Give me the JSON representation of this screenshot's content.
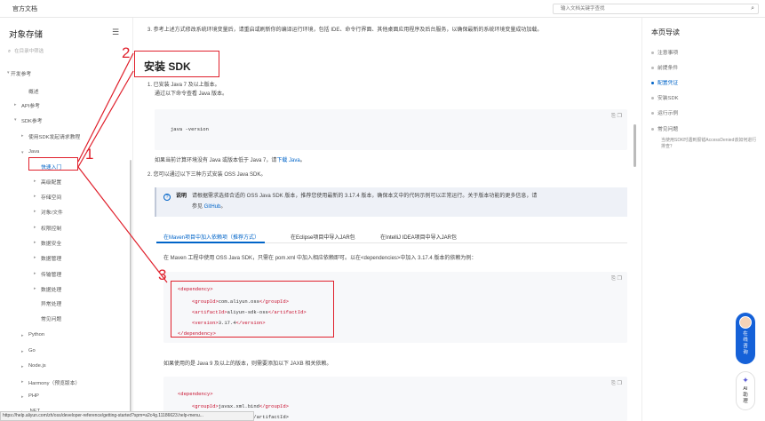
{
  "topbar": {
    "brand": "官方文档",
    "search_placeholder": "输入文档关键字查找",
    "search_icon": "search-icon"
  },
  "sidebar": {
    "title": "对象存储",
    "filter_placeholder": "在目录中筛选",
    "items": [
      {
        "label": "开发参考",
        "arrow": "▾"
      },
      {
        "label": "概述",
        "arrow": ""
      },
      {
        "label": "API参考",
        "arrow": "▸"
      },
      {
        "label": "SDK参考",
        "arrow": "▾"
      },
      {
        "label": "使用SDK发起请求教程",
        "arrow": "▸"
      },
      {
        "label": "Java",
        "arrow": "▾"
      },
      {
        "label": "快速入门",
        "arrow": ""
      },
      {
        "label": "高级配置",
        "arrow": "▸"
      },
      {
        "label": "存储空间",
        "arrow": "▸"
      },
      {
        "label": "对象/文件",
        "arrow": "▸"
      },
      {
        "label": "权限控制",
        "arrow": "▸"
      },
      {
        "label": "数据安全",
        "arrow": "▸"
      },
      {
        "label": "数据管理",
        "arrow": "▸"
      },
      {
        "label": "传输管理",
        "arrow": "▸"
      },
      {
        "label": "数据处理",
        "arrow": "▸"
      },
      {
        "label": "异常处理",
        "arrow": ""
      },
      {
        "label": "常见问题",
        "arrow": ""
      },
      {
        "label": "Python",
        "arrow": "▸"
      },
      {
        "label": "Go",
        "arrow": "▸"
      },
      {
        "label": "Node.js",
        "arrow": "▸"
      },
      {
        "label": "Harmony（预览版本）",
        "arrow": "▸"
      },
      {
        "label": "PHP",
        "arrow": "▸"
      },
      {
        "label": ".NET",
        "arrow": "▸"
      }
    ]
  },
  "status_url": "https://help.aliyun.com/zh/oss/developer-reference/getting-started?spm=a2c4g.11186623.help-menu...",
  "content": {
    "step3": "3. 参考上述方式修改系统环境变量后，请重启或刷新你的编译运行环境，包括 IDE、命令行界面、其他桌面应用程序及后台服务，以确保最新的系统环境变量成功加载。",
    "heading": "安装 SDK",
    "item1": "1. 已安装 Java 7 及以上版本。",
    "item1_sub": "通过以下命令查看 Java 版本。",
    "cmd": "java -version",
    "java_note_prefix": "如果当前计算环境没有 Java 或版本低于 Java 7，请",
    "java_note_link": "下载 Java",
    "java_note_suffix": "。",
    "item2": "2. 您可以通过以下三种方式安装 OSS Java SDK。",
    "note_title": "说明",
    "note_line1": "请根据需求选择合适的 OSS Java SDK 版本，推荐您使用最新的 3.17.4 版本，确保本文中的代码示例可以正常运行。关于版本功能的更多信息，请",
    "note_line2_prefix": "参见 ",
    "note_link": "GitHub",
    "note_line2_suffix": "。",
    "tabs": [
      "在Maven项目中加入依赖项（推荐方式）",
      "在Eclipse项目中导入JAR包",
      "在IntelliJ IDEA项目中导入JAR包"
    ],
    "maven_text": "在 Maven 工程中使用 OSS Java SDK，只需在 pom.xml 中加入相应依赖即可。以在<dependencies>中加入 3.17.4 版本的依赖为例：",
    "dep": {
      "open": "<dependency>",
      "group_open": "<groupId>",
      "group_val": "com.aliyun.oss",
      "group_close": "</groupId>",
      "artifact_open": "<artifactId>",
      "artifact_val": "aliyun-sdk-oss",
      "artifact_close": "</artifactId>",
      "version_open": "<version>",
      "version_val": "3.17.4",
      "version_close": "</version>",
      "close": "</dependency>"
    },
    "java9_text": "如果使用的是 Java 9 及以上的版本，则需要添加以下 JAXB 相关依赖。",
    "dep2": {
      "open": "<dependency>",
      "group_open": "<groupId>",
      "group_val": "javax.xml.bind",
      "group_close": "</groupId>",
      "artifact_partial": "<artifactId>jaxb-api</artifactId>"
    }
  },
  "toc": {
    "title": "本页导读",
    "items": [
      "注意事项",
      "前提条件",
      "配置凭证",
      "安装SDK",
      "运行示例",
      "常见问题"
    ],
    "active_index": 2,
    "sub": "当使用SDK时遇到报错AccessDenied该如何进行排查？"
  },
  "float": {
    "online": "在线咨询",
    "ai": "AI助理"
  },
  "annotations": [
    "1",
    "2",
    "3"
  ],
  "colors": {
    "accent": "#0064c8",
    "annotation": "#e0202c"
  }
}
